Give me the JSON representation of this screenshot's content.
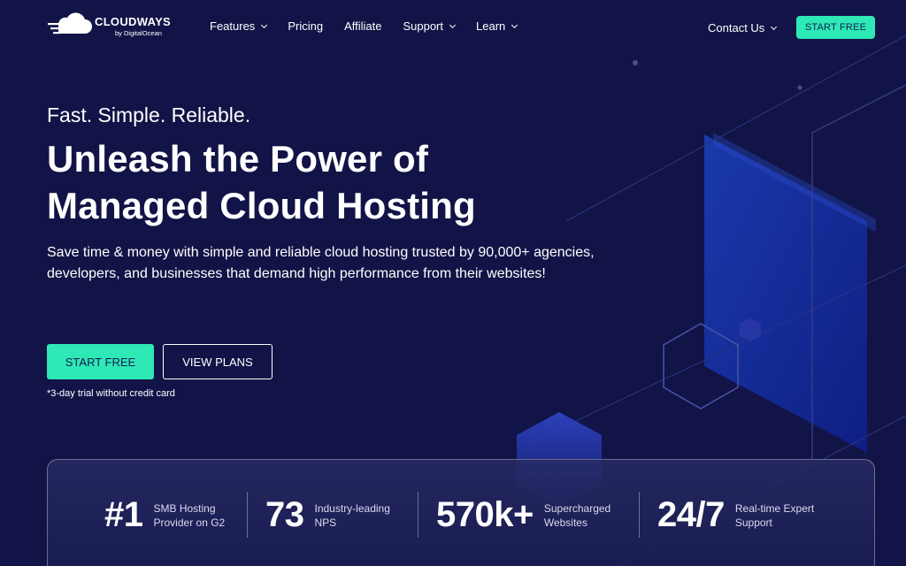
{
  "brand": {
    "name": "CLOUDWAYS",
    "sub": "by DigitalOcean"
  },
  "nav": {
    "items": [
      {
        "label": "Features",
        "has_dropdown": true
      },
      {
        "label": "Pricing",
        "has_dropdown": false
      },
      {
        "label": "Affiliate",
        "has_dropdown": false
      },
      {
        "label": "Support",
        "has_dropdown": true
      },
      {
        "label": "Learn",
        "has_dropdown": true
      }
    ],
    "contact": "Contact Us",
    "cta": "START FREE"
  },
  "hero": {
    "tagline": "Fast. Simple. Reliable.",
    "headline_line1": "Unleash the Power of",
    "headline_line2": "Managed Cloud Hosting",
    "description": "Save time & money with simple and reliable cloud hosting trusted by 90,000+ agencies, developers, and businesses that demand high performance from their websites!",
    "primary_button": "START FREE",
    "secondary_button": "VIEW PLANS",
    "note": "*3-day trial without credit card"
  },
  "stats": [
    {
      "value": "#1",
      "label": "SMB Hosting Provider on G2"
    },
    {
      "value": "73",
      "label": "Industry-leading NPS"
    },
    {
      "value": "570k+",
      "label": "Supercharged Websites"
    },
    {
      "value": "24/7",
      "label": "Real-time Expert Support"
    }
  ],
  "colors": {
    "background": "#121447",
    "accent": "#2ee8b6",
    "button_text": "#142052"
  },
  "icons": [
    "cloudways-logo-icon",
    "chevron-down-icon"
  ]
}
